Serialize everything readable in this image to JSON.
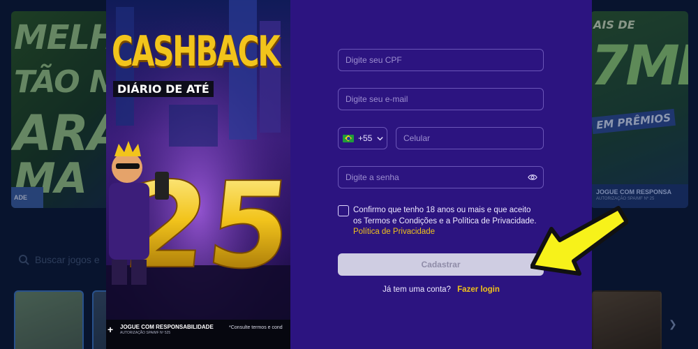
{
  "background": {
    "left_banner": {
      "line1": "MELHO",
      "line2": "TÃO NA",
      "line3": "ARA",
      "line4": "MA",
      "chip": "ADE"
    },
    "right_banner": {
      "line1": "AIS DE",
      "line2": "7MI",
      "line3": "EM PRÊMIOS",
      "foot_a": "JOGUE COM RESPONSA",
      "foot_b": "AUTORIZAÇÃO SPA/MF Nº 25"
    },
    "search_placeholder": "Buscar jogos e",
    "next_icon": "chevron-right-icon"
  },
  "promo": {
    "title": "CASHBACK",
    "subtitle": "DIÁRIO DE ATÉ",
    "percent": "25%",
    "footer_logo": "+",
    "footer_line1": "JOGUE COM RESPONSABILIDADE",
    "footer_line2": "AUTORIZAÇÃO SPA/MF Nº 525",
    "footer_note": "*Consulte termos e cond"
  },
  "form": {
    "cpf_placeholder": "Digite seu CPF",
    "email_placeholder": "Digite seu e-mail",
    "country_code": "+55",
    "phone_placeholder": "Celular",
    "password_placeholder": "Digite a senha",
    "terms_line1": "Confirmo que tenho 18 anos ou mais e que aceito",
    "terms_line2": "os Termos e Condições e a Política de Privacidade.",
    "privacy_link": "Política de Privacidade",
    "submit_label": "Cadastrar",
    "have_account": "Já tem uma conta?",
    "login_link": "Fazer login"
  },
  "colors": {
    "panel": "#2c1480",
    "accent": "#f0c21a",
    "field_border": "#6b56b8",
    "button_disabled": "#cfcde2",
    "arrow": "#f7f21a"
  }
}
